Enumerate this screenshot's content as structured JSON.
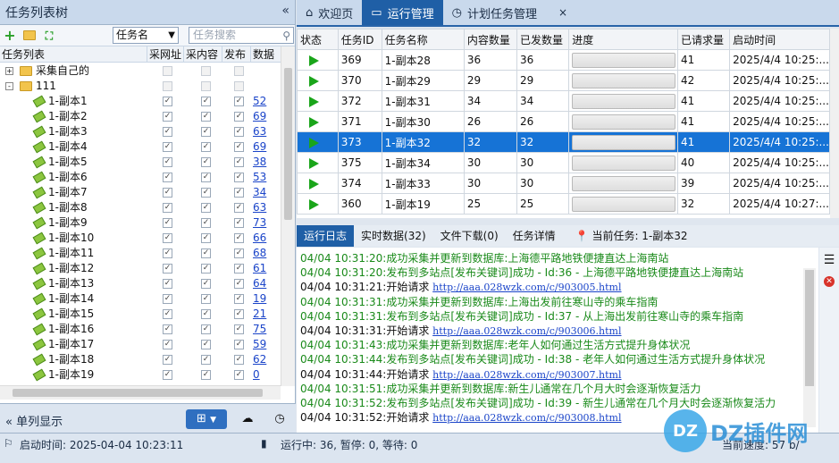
{
  "left": {
    "title": "任务列表树",
    "collapse_icon": "«",
    "select_value": "任务名",
    "search_placeholder": "任务搜索",
    "headers": [
      "任务列表",
      "采网址",
      "采内容",
      "发布",
      "数据"
    ],
    "root_nodes": [
      {
        "label": "采集自己的",
        "expander": "+"
      },
      {
        "label": "111",
        "expander": "-"
      }
    ],
    "tasks": [
      {
        "label": "1-副本1",
        "count": "52"
      },
      {
        "label": "1-副本2",
        "count": "69"
      },
      {
        "label": "1-副本3",
        "count": "63"
      },
      {
        "label": "1-副本4",
        "count": "69"
      },
      {
        "label": "1-副本5",
        "count": "38"
      },
      {
        "label": "1-副本6",
        "count": "53"
      },
      {
        "label": "1-副本7",
        "count": "34"
      },
      {
        "label": "1-副本8",
        "count": "63"
      },
      {
        "label": "1-副本9",
        "count": "73"
      },
      {
        "label": "1-副本10",
        "count": "66"
      },
      {
        "label": "1-副本11",
        "count": "68"
      },
      {
        "label": "1-副本12",
        "count": "61"
      },
      {
        "label": "1-副本13",
        "count": "64"
      },
      {
        "label": "1-副本14",
        "count": "19"
      },
      {
        "label": "1-副本15",
        "count": "21"
      },
      {
        "label": "1-副本16",
        "count": "75"
      },
      {
        "label": "1-副本17",
        "count": "59"
      },
      {
        "label": "1-副本18",
        "count": "62"
      },
      {
        "label": "1-副本19",
        "count": "0"
      }
    ],
    "single_col": "单列显示"
  },
  "tabs": [
    {
      "label": "欢迎页"
    },
    {
      "label": "运行管理"
    },
    {
      "label": "计划任务管理",
      "close": "×"
    }
  ],
  "grid": {
    "headers": [
      "状态",
      "任务ID",
      "任务名称",
      "内容数量",
      "已发数量",
      "进度",
      "已请求量",
      "启动时间"
    ],
    "rows": [
      {
        "id": "369",
        "name": "1-副本28",
        "content": "36",
        "sent": "36",
        "req": "41",
        "time": "2025/4/4 10:25:..."
      },
      {
        "id": "370",
        "name": "1-副本29",
        "content": "29",
        "sent": "29",
        "req": "42",
        "time": "2025/4/4 10:25:..."
      },
      {
        "id": "372",
        "name": "1-副本31",
        "content": "34",
        "sent": "34",
        "req": "41",
        "time": "2025/4/4 10:25:..."
      },
      {
        "id": "371",
        "name": "1-副本30",
        "content": "26",
        "sent": "26",
        "req": "41",
        "time": "2025/4/4 10:25:..."
      },
      {
        "id": "373",
        "name": "1-副本32",
        "content": "32",
        "sent": "32",
        "req": "41",
        "time": "2025/4/4 10:25:..."
      },
      {
        "id": "375",
        "name": "1-副本34",
        "content": "30",
        "sent": "30",
        "req": "40",
        "time": "2025/4/4 10:25:..."
      },
      {
        "id": "374",
        "name": "1-副本33",
        "content": "30",
        "sent": "30",
        "req": "39",
        "time": "2025/4/4 10:25:..."
      },
      {
        "id": "360",
        "name": "1-副本19",
        "content": "25",
        "sent": "25",
        "req": "32",
        "time": "2025/4/4 10:27:..."
      }
    ]
  },
  "log_tabs": [
    "运行日志",
    "实时数据(32)",
    "文件下载(0)",
    "任务详情"
  ],
  "current_task": "当前任务: 1-副本32",
  "logs": [
    {
      "c": "green",
      "t": "04/04 10:31:20:成功采集并更新到数据库:上海德平路地铁便捷直达上海南站"
    },
    {
      "c": "green",
      "t": "04/04 10:31:20:发布到多站点[发布关键词]成功 - Id:36 - 上海德平路地铁便捷直达上海南站"
    },
    {
      "c": "black",
      "t": "04/04 10:31:21:开始请求 ",
      "u": "http://aaa.028wzk.com/c/903005.html"
    },
    {
      "c": "green",
      "t": "04/04 10:31:31:成功采集并更新到数据库:上海出发前往寒山寺的乘车指南"
    },
    {
      "c": "green",
      "t": "04/04 10:31:31:发布到多站点[发布关键词]成功 - Id:37 - 从上海出发前往寒山寺的乘车指南"
    },
    {
      "c": "black",
      "t": "04/04 10:31:31:开始请求 ",
      "u": "http://aaa.028wzk.com/c/903006.html"
    },
    {
      "c": "green",
      "t": "04/04 10:31:43:成功采集并更新到数据库:老年人如何通过生活方式提升身体状况"
    },
    {
      "c": "green",
      "t": "04/04 10:31:44:发布到多站点[发布关键词]成功 - Id:38 - 老年人如何通过生活方式提升身体状况"
    },
    {
      "c": "black",
      "t": "04/04 10:31:44:开始请求 ",
      "u": "http://aaa.028wzk.com/c/903007.html"
    },
    {
      "c": "green",
      "t": "04/04 10:31:51:成功采集并更新到数据库:新生儿通常在几个月大时会逐渐恢复活力"
    },
    {
      "c": "green",
      "t": "04/04 10:31:52:发布到多站点[发布关键词]成功 - Id:39 - 新生儿通常在几个月大时会逐渐恢复活力"
    },
    {
      "c": "black",
      "t": "04/04 10:31:52:开始请求 ",
      "u": "http://aaa.028wzk.com/c/903008.html"
    }
  ],
  "status": {
    "start_time": "启动时间: 2025-04-04 10:23:11",
    "running": "运行中: 36, 暂停: 0, 等待: 0",
    "speed": "当前速度: 57 b/"
  },
  "watermark": {
    "text": "DZ插件网",
    "logo": "DZ"
  }
}
